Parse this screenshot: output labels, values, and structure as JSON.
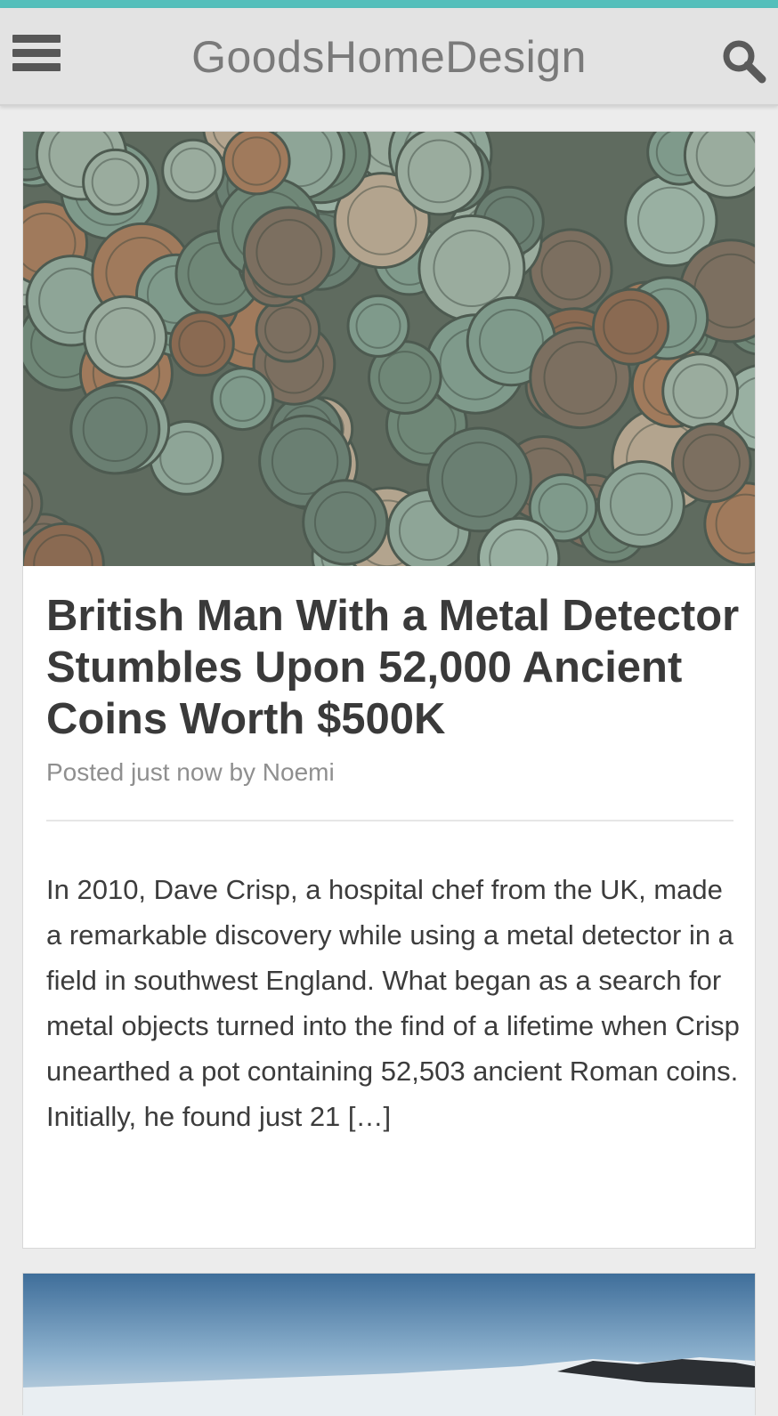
{
  "header": {
    "site_title": "GoodsHomeDesign",
    "menu_icon": "hamburger-menu-icon",
    "search_icon": "search-icon",
    "accent_color": "#54bfbb"
  },
  "posts": [
    {
      "title": "British Man With a Metal Detector Stumbles Upon 52,000 Ancient Coins Worth $500K",
      "meta": "Posted just now by Noemi",
      "excerpt": "In 2010, Dave Crisp, a hospital chef from the UK, made a remarkable discovery while using a metal detector in a field in southwest England. What began as a search for metal objects turned into the find of a lifetime when Crisp unearthed a pot containing 52,503 ancient Roman coins. Initially, he found just 21 […]"
    }
  ]
}
